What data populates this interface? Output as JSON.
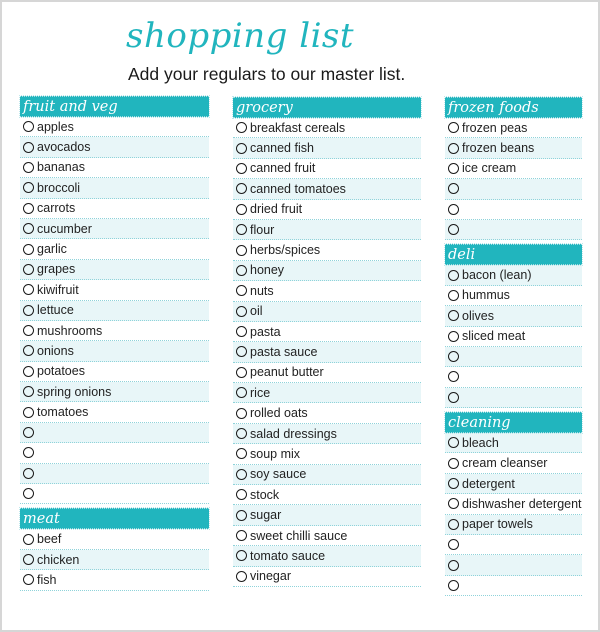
{
  "header": {
    "title": "shopping list",
    "subtitle": "Add your regulars to our master list."
  },
  "colors": {
    "accent": "#21b5be",
    "row_tint": "#e8f6f8",
    "border": "#d6d6d6"
  },
  "icons": {
    "checkbox": "radio-circle-icon"
  },
  "columns": [
    {
      "sections": [
        {
          "title": "fruit and veg",
          "first_tinted": false,
          "items": [
            "apples",
            "avocados",
            "bananas",
            "broccoli",
            "carrots",
            "cucumber",
            "garlic",
            "grapes",
            "kiwifruit",
            "lettuce",
            "mushrooms",
            "onions",
            "potatoes",
            "spring onions",
            "tomatoes",
            "",
            "",
            "",
            ""
          ]
        },
        {
          "title": "meat",
          "first_tinted": false,
          "items": [
            "beef",
            "chicken",
            "fish"
          ]
        }
      ]
    },
    {
      "sections": [
        {
          "title": "grocery",
          "first_tinted": false,
          "items": [
            "breakfast cereals",
            "canned fish",
            "canned fruit",
            "canned tomatoes",
            "dried fruit",
            "flour",
            "herbs/spices",
            "honey",
            "nuts",
            "oil",
            "pasta",
            "pasta sauce",
            "peanut butter",
            "rice",
            "rolled oats",
            "salad dressings",
            "soup mix",
            "soy sauce",
            "stock",
            "sugar",
            "sweet chilli sauce",
            "tomato sauce",
            "vinegar"
          ]
        }
      ]
    },
    {
      "sections": [
        {
          "title": "frozen foods",
          "first_tinted": false,
          "items": [
            "frozen peas",
            "frozen beans",
            "ice cream",
            "",
            "",
            ""
          ]
        },
        {
          "title": "deli",
          "first_tinted": true,
          "items": [
            "bacon (lean)",
            "hummus",
            "olives",
            "sliced meat",
            "",
            "",
            ""
          ]
        },
        {
          "title": "cleaning",
          "first_tinted": true,
          "items": [
            "bleach",
            "cream cleanser",
            "detergent",
            "dishwasher detergent",
            "paper towels",
            "",
            "",
            ""
          ]
        }
      ]
    }
  ]
}
